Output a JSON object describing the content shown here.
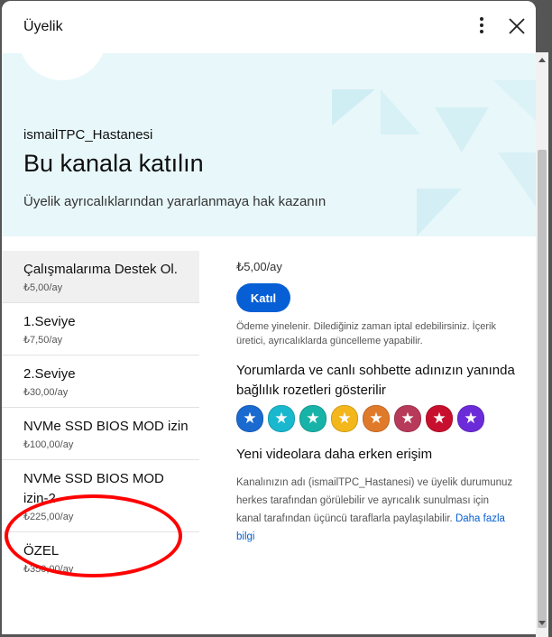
{
  "dialog": {
    "title": "Üyelik"
  },
  "hero": {
    "channel": "ismailTPC_Hastanesi",
    "heading": "Bu kanala katılın",
    "subtitle": "Üyelik ayrıcalıklarından yararlanmaya hak kazanın"
  },
  "tiers": [
    {
      "name": "Çalışmalarıma Destek Ol.",
      "price": "₺5,00/ay",
      "selected": true
    },
    {
      "name": "1.Seviye",
      "price": "₺7,50/ay"
    },
    {
      "name": "2.Seviye",
      "price": "₺30,00/ay"
    },
    {
      "name": "NVMe SSD BIOS MOD izin",
      "price": "₺100,00/ay"
    },
    {
      "name": "NVMe SSD BIOS MOD izin-2",
      "price": "₺225,00/ay"
    },
    {
      "name": "ÖZEL",
      "price": "₺350,00/ay"
    }
  ],
  "detail": {
    "price": "₺5,00/ay",
    "join_label": "Katıl",
    "note": "Ödeme yinelenir. Dilediğiniz zaman iptal edebilirsiniz. İçerik üretici, ayrıcalıklarda güncelleme yapabilir.",
    "perk1": "Yorumlarda ve canlı sohbette adınızın yanında bağlılık rozetleri gösterilir",
    "badge_colors": [
      "#1a6ad0",
      "#19b8cf",
      "#17b3a8",
      "#f3b71c",
      "#e07a2b",
      "#b83a5a",
      "#c8102e",
      "#6c2bd9"
    ],
    "perk2": "Yeni videolara daha erken erişim",
    "desc": "Kanalınızın adı (ismailTPC_Hastanesi) ve üyelik durumunuz herkes tarafından görülebilir ve ayrıcalık sunulması için kanal tarafından üçüncü taraflarla paylaşılabilir.",
    "more_link": "Daha fazla bilgi"
  },
  "annotation": {
    "color": "#ff0000",
    "highlighted_tier": "NVMe SSD BIOS MOD izin-2"
  }
}
